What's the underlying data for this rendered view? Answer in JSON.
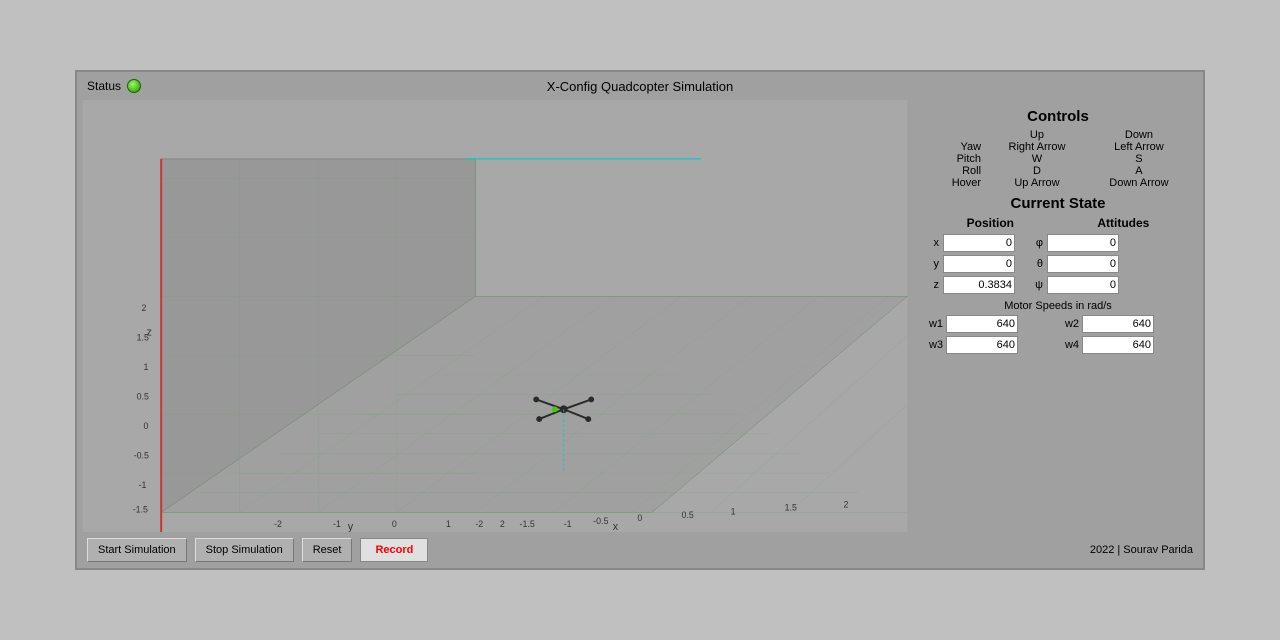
{
  "window": {
    "title": "X-Config Quadcopter Simulation"
  },
  "status": {
    "label": "Status",
    "color": "#44cc00"
  },
  "controls": {
    "title": "Controls",
    "header_up": "Up",
    "header_down": "Down",
    "rows": [
      {
        "label": "Yaw",
        "up": "Right Arrow",
        "down": "Left Arrow"
      },
      {
        "label": "Pitch",
        "up": "W",
        "down": "S"
      },
      {
        "label": "Roll",
        "up": "D",
        "down": "A"
      },
      {
        "label": "Hover",
        "up": "Up Arrow",
        "down": "Down Arrow"
      }
    ]
  },
  "current_state": {
    "title": "Current State",
    "position_label": "Position",
    "attitudes_label": "Attitudes",
    "position": {
      "x": {
        "label": "x",
        "value": "0"
      },
      "y": {
        "label": "y",
        "value": "0"
      },
      "z": {
        "label": "z",
        "value": "0.3834"
      }
    },
    "attitudes": {
      "phi": {
        "label": "φ",
        "value": "0"
      },
      "theta": {
        "label": "θ",
        "value": "0"
      },
      "psi": {
        "label": "ψ",
        "value": "0"
      }
    }
  },
  "motor_speeds": {
    "title": "Motor Speeds in rad/s",
    "w1": {
      "label": "w1",
      "value": "640"
    },
    "w2": {
      "label": "w2",
      "value": "640"
    },
    "w3": {
      "label": "w3",
      "value": "640"
    },
    "w4": {
      "label": "w4",
      "value": "640"
    }
  },
  "buttons": {
    "start": "Start Simulation",
    "stop": "Stop Simulation",
    "reset": "Reset",
    "record": "Record"
  },
  "footer": "2022 | Sourav Parida"
}
